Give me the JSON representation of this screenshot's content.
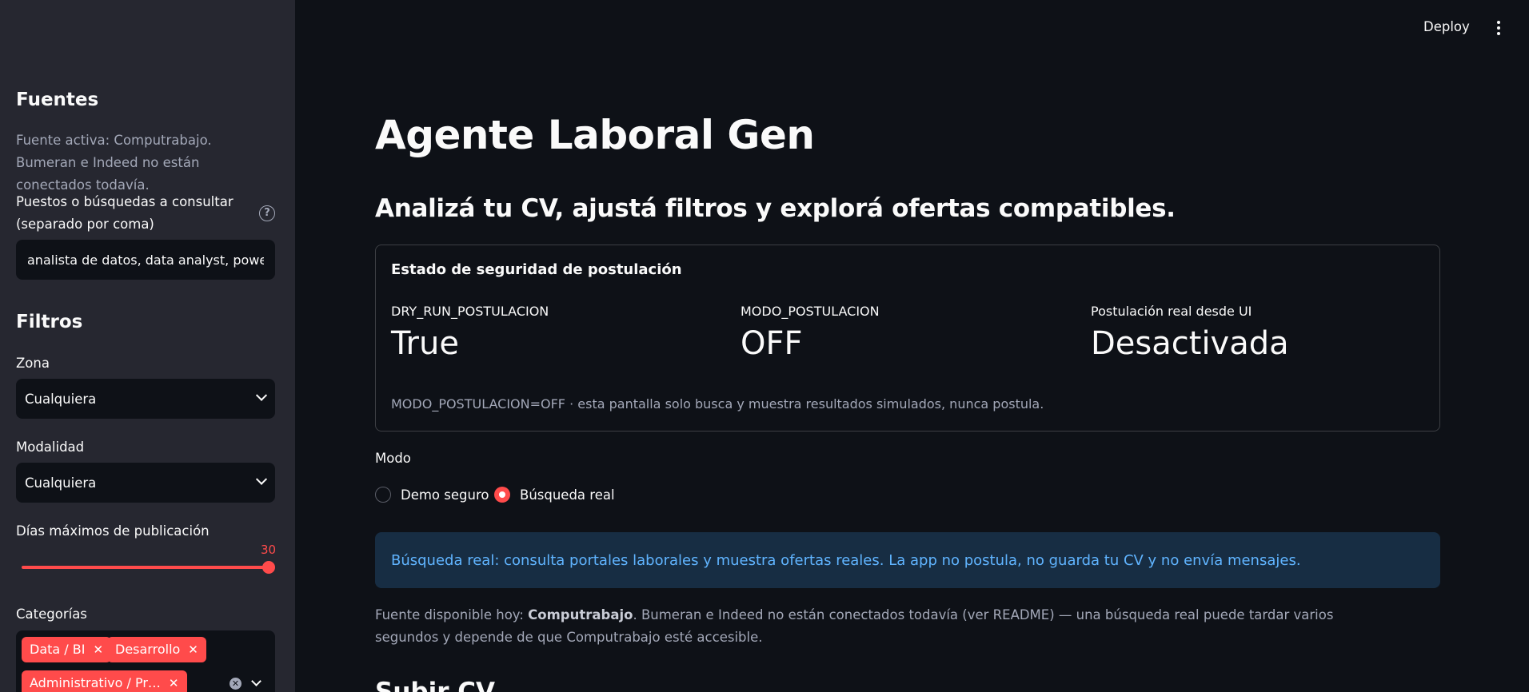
{
  "sidebar": {
    "sources_heading": "Fuentes",
    "sources_caption": "Fuente activa: Computrabajo. Bumeran e Indeed no están conectados todavía.",
    "searches_label": "Puestos o búsquedas a consultar (separado por coma)",
    "searches_value": "analista de datos, data analyst, power bi,",
    "filters_heading": "Filtros",
    "zona_label": "Zona",
    "zona_value": "Cualquiera",
    "modalidad_label": "Modalidad",
    "modalidad_value": "Cualquiera",
    "dias_label": "Días máximos de publicación",
    "dias_value": "30",
    "categorias_label": "Categorías",
    "categorias_chips": [
      "Data / BI",
      "Desarrollo",
      "Administrativo / Pr…"
    ]
  },
  "header": {
    "deploy_label": "Deploy"
  },
  "main": {
    "title": "Agente Laboral Gen",
    "subtitle": "Analizá tu CV, ajustá filtros y explorá ofertas compatibles.",
    "security_card": {
      "title": "Estado de seguridad de postulación",
      "metrics": [
        {
          "label": "DRY_RUN_POSTULACION",
          "value": "True"
        },
        {
          "label": "MODO_POSTULACION",
          "value": "OFF"
        },
        {
          "label": "Postulación real desde UI",
          "value": "Desactivada"
        }
      ],
      "caption": "MODO_POSTULACION=OFF · esta pantalla solo busca y muestra resultados simulados, nunca postula."
    },
    "modo_label": "Modo",
    "modo_options": [
      {
        "label": "Demo seguro",
        "selected": false
      },
      {
        "label": "Búsqueda real",
        "selected": true
      }
    ],
    "info_text": "Búsqueda real: consulta portales laborales y muestra ofertas reales. La app no postula, no guarda tu CV y no envía mensajes.",
    "source_caption": {
      "prefix": "Fuente disponible hoy: ",
      "source": "Computrabajo",
      "suffix": ". Bumeran e Indeed no están conectados todavía (ver README) — una búsqueda real puede tardar varios segundos y depende de que Computrabajo esté accesible."
    },
    "next_section_heading": "Subir CV"
  },
  "colors": {
    "accent": "#ff4b4b",
    "background": "#0e1117",
    "sidebar_bg": "#262730",
    "info_bg": "#172d43",
    "info_text": "#60b4ff"
  }
}
